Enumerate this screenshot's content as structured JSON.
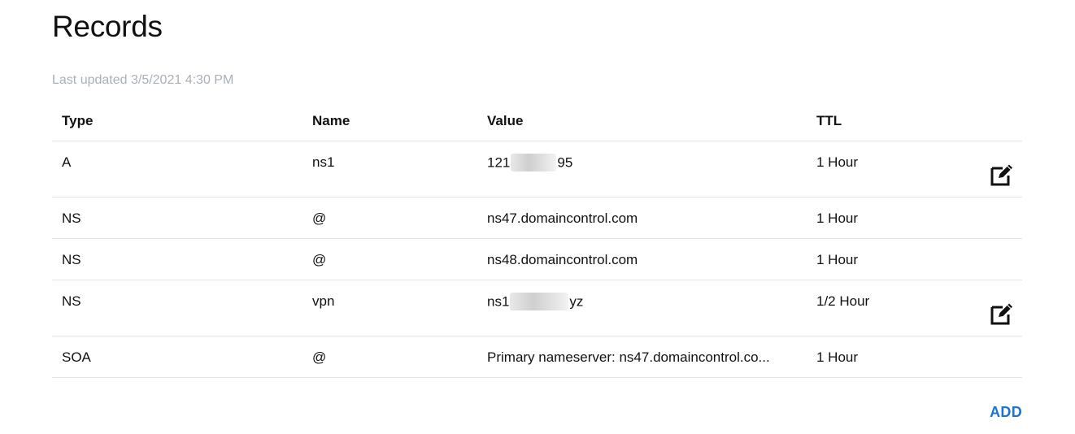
{
  "page": {
    "title": "Records",
    "last_updated": "Last updated 3/5/2021 4:30 PM"
  },
  "table": {
    "headers": {
      "type": "Type",
      "name": "Name",
      "value": "Value",
      "ttl": "TTL"
    },
    "rows": [
      {
        "type": "A",
        "name": "ns1",
        "value_prefix": "121",
        "value_suffix": "95",
        "ttl": "1 Hour",
        "editable": true
      },
      {
        "type": "NS",
        "name": "@",
        "value": "ns47.domaincontrol.com",
        "ttl": "1 Hour",
        "editable": false
      },
      {
        "type": "NS",
        "name": "@",
        "value": "ns48.domaincontrol.com",
        "ttl": "1 Hour",
        "editable": false
      },
      {
        "type": "NS",
        "name": "vpn",
        "value_prefix": "ns1",
        "value_suffix": "yz",
        "ttl": "1/2 Hour",
        "editable": true
      },
      {
        "type": "SOA",
        "name": "@",
        "value": "Primary nameserver: ns47.domaincontrol.co...",
        "ttl": "1 Hour",
        "editable": false
      }
    ]
  },
  "actions": {
    "add_label": "ADD"
  },
  "colors": {
    "accent": "#1b75d0",
    "muted_text": "#a9b0b7",
    "divider": "#e4e4e4"
  },
  "icons": {
    "edit": "edit-icon"
  }
}
